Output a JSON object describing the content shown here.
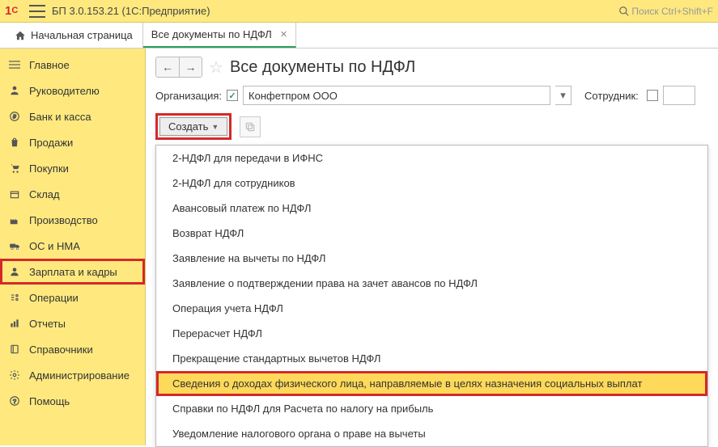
{
  "header": {
    "app_title": "БП 3.0.153.21 (1С:Предприятие)",
    "search_placeholder": "Поиск Ctrl+Shift+F"
  },
  "tabs": {
    "home": "Начальная страница",
    "doc": "Все документы по НДФЛ"
  },
  "sidebar": [
    {
      "label": "Главное",
      "icon": "menu"
    },
    {
      "label": "Руководителю",
      "icon": "person"
    },
    {
      "label": "Банк и касса",
      "icon": "coin"
    },
    {
      "label": "Продажи",
      "icon": "bag"
    },
    {
      "label": "Покупки",
      "icon": "cart"
    },
    {
      "label": "Склад",
      "icon": "box"
    },
    {
      "label": "Производство",
      "icon": "factory"
    },
    {
      "label": "ОС и НМА",
      "icon": "truck"
    },
    {
      "label": "Зарплата и кадры",
      "icon": "user",
      "highlighted": true
    },
    {
      "label": "Операции",
      "icon": "ops"
    },
    {
      "label": "Отчеты",
      "icon": "chart"
    },
    {
      "label": "Справочники",
      "icon": "book"
    },
    {
      "label": "Администрирование",
      "icon": "gear"
    },
    {
      "label": "Помощь",
      "icon": "help"
    }
  ],
  "page": {
    "title": "Все документы по НДФЛ",
    "org_label": "Организация:",
    "org_value": "Конфетпром ООО",
    "emp_label": "Сотрудник:",
    "create_label": "Создать"
  },
  "menu": [
    "2-НДФЛ для передачи в ИФНС",
    "2-НДФЛ для сотрудников",
    "Авансовый платеж по НДФЛ",
    "Возврат НДФЛ",
    "Заявление на вычеты по НДФЛ",
    "Заявление о подтверждении права на зачет авансов по НДФЛ",
    "Операция учета НДФЛ",
    "Перерасчет НДФЛ",
    "Прекращение стандартных вычетов НДФЛ",
    "Сведения о доходах физического лица, направляемые в целях назначения социальных выплат",
    "Справки по НДФЛ для Расчета по налогу на прибыль",
    "Уведомление налогового органа о праве на вычеты"
  ],
  "menu_selected_index": 9
}
